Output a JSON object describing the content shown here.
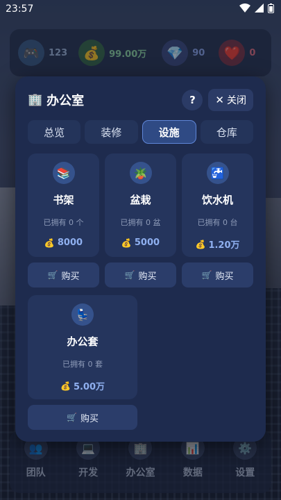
{
  "status": {
    "time": "23:57",
    "wifi_icon": "wifi-icon",
    "signal_icon": "signal-icon",
    "battery_icon": "battery-icon"
  },
  "resources": [
    {
      "icon": "🎮",
      "value": "123"
    },
    {
      "icon": "💰",
      "value": "99.00万"
    },
    {
      "icon": "💎",
      "value": "90"
    },
    {
      "icon": "❤️",
      "value": "0"
    }
  ],
  "modal": {
    "title_icon": "🏢",
    "title": "办公室",
    "help_label": "?",
    "close_icon": "✕",
    "close_label": "关闭",
    "tabs": [
      {
        "label": "总览",
        "active": false
      },
      {
        "label": "装修",
        "active": false
      },
      {
        "label": "设施",
        "active": true
      },
      {
        "label": "仓库",
        "active": false
      }
    ],
    "items": [
      {
        "icon": "📚",
        "name": "书架",
        "owned": "已拥有 0 个",
        "price_icon": "💰",
        "price": "8000",
        "buy_icon": "🛒",
        "buy_label": "购买"
      },
      {
        "icon": "🪴",
        "name": "盆栽",
        "owned": "已拥有 0 盆",
        "price_icon": "💰",
        "price": "5000",
        "buy_icon": "🛒",
        "buy_label": "购买"
      },
      {
        "icon": "🚰",
        "name": "饮水机",
        "owned": "已拥有 0 台",
        "price_icon": "💰",
        "price": "1.20万",
        "buy_icon": "🛒",
        "buy_label": "购买"
      },
      {
        "icon": "💺",
        "name": "办公套",
        "owned": "已拥有 0 套",
        "price_icon": "💰",
        "price": "5.00万",
        "buy_icon": "🛒",
        "buy_label": "购买"
      }
    ]
  },
  "bottom_nav": [
    {
      "icon": "👥",
      "label": "团队"
    },
    {
      "icon": "💻",
      "label": "开发"
    },
    {
      "icon": "🏢",
      "label": "办公室"
    },
    {
      "icon": "📊",
      "label": "数据"
    },
    {
      "icon": "⚙️",
      "label": "设置"
    }
  ]
}
